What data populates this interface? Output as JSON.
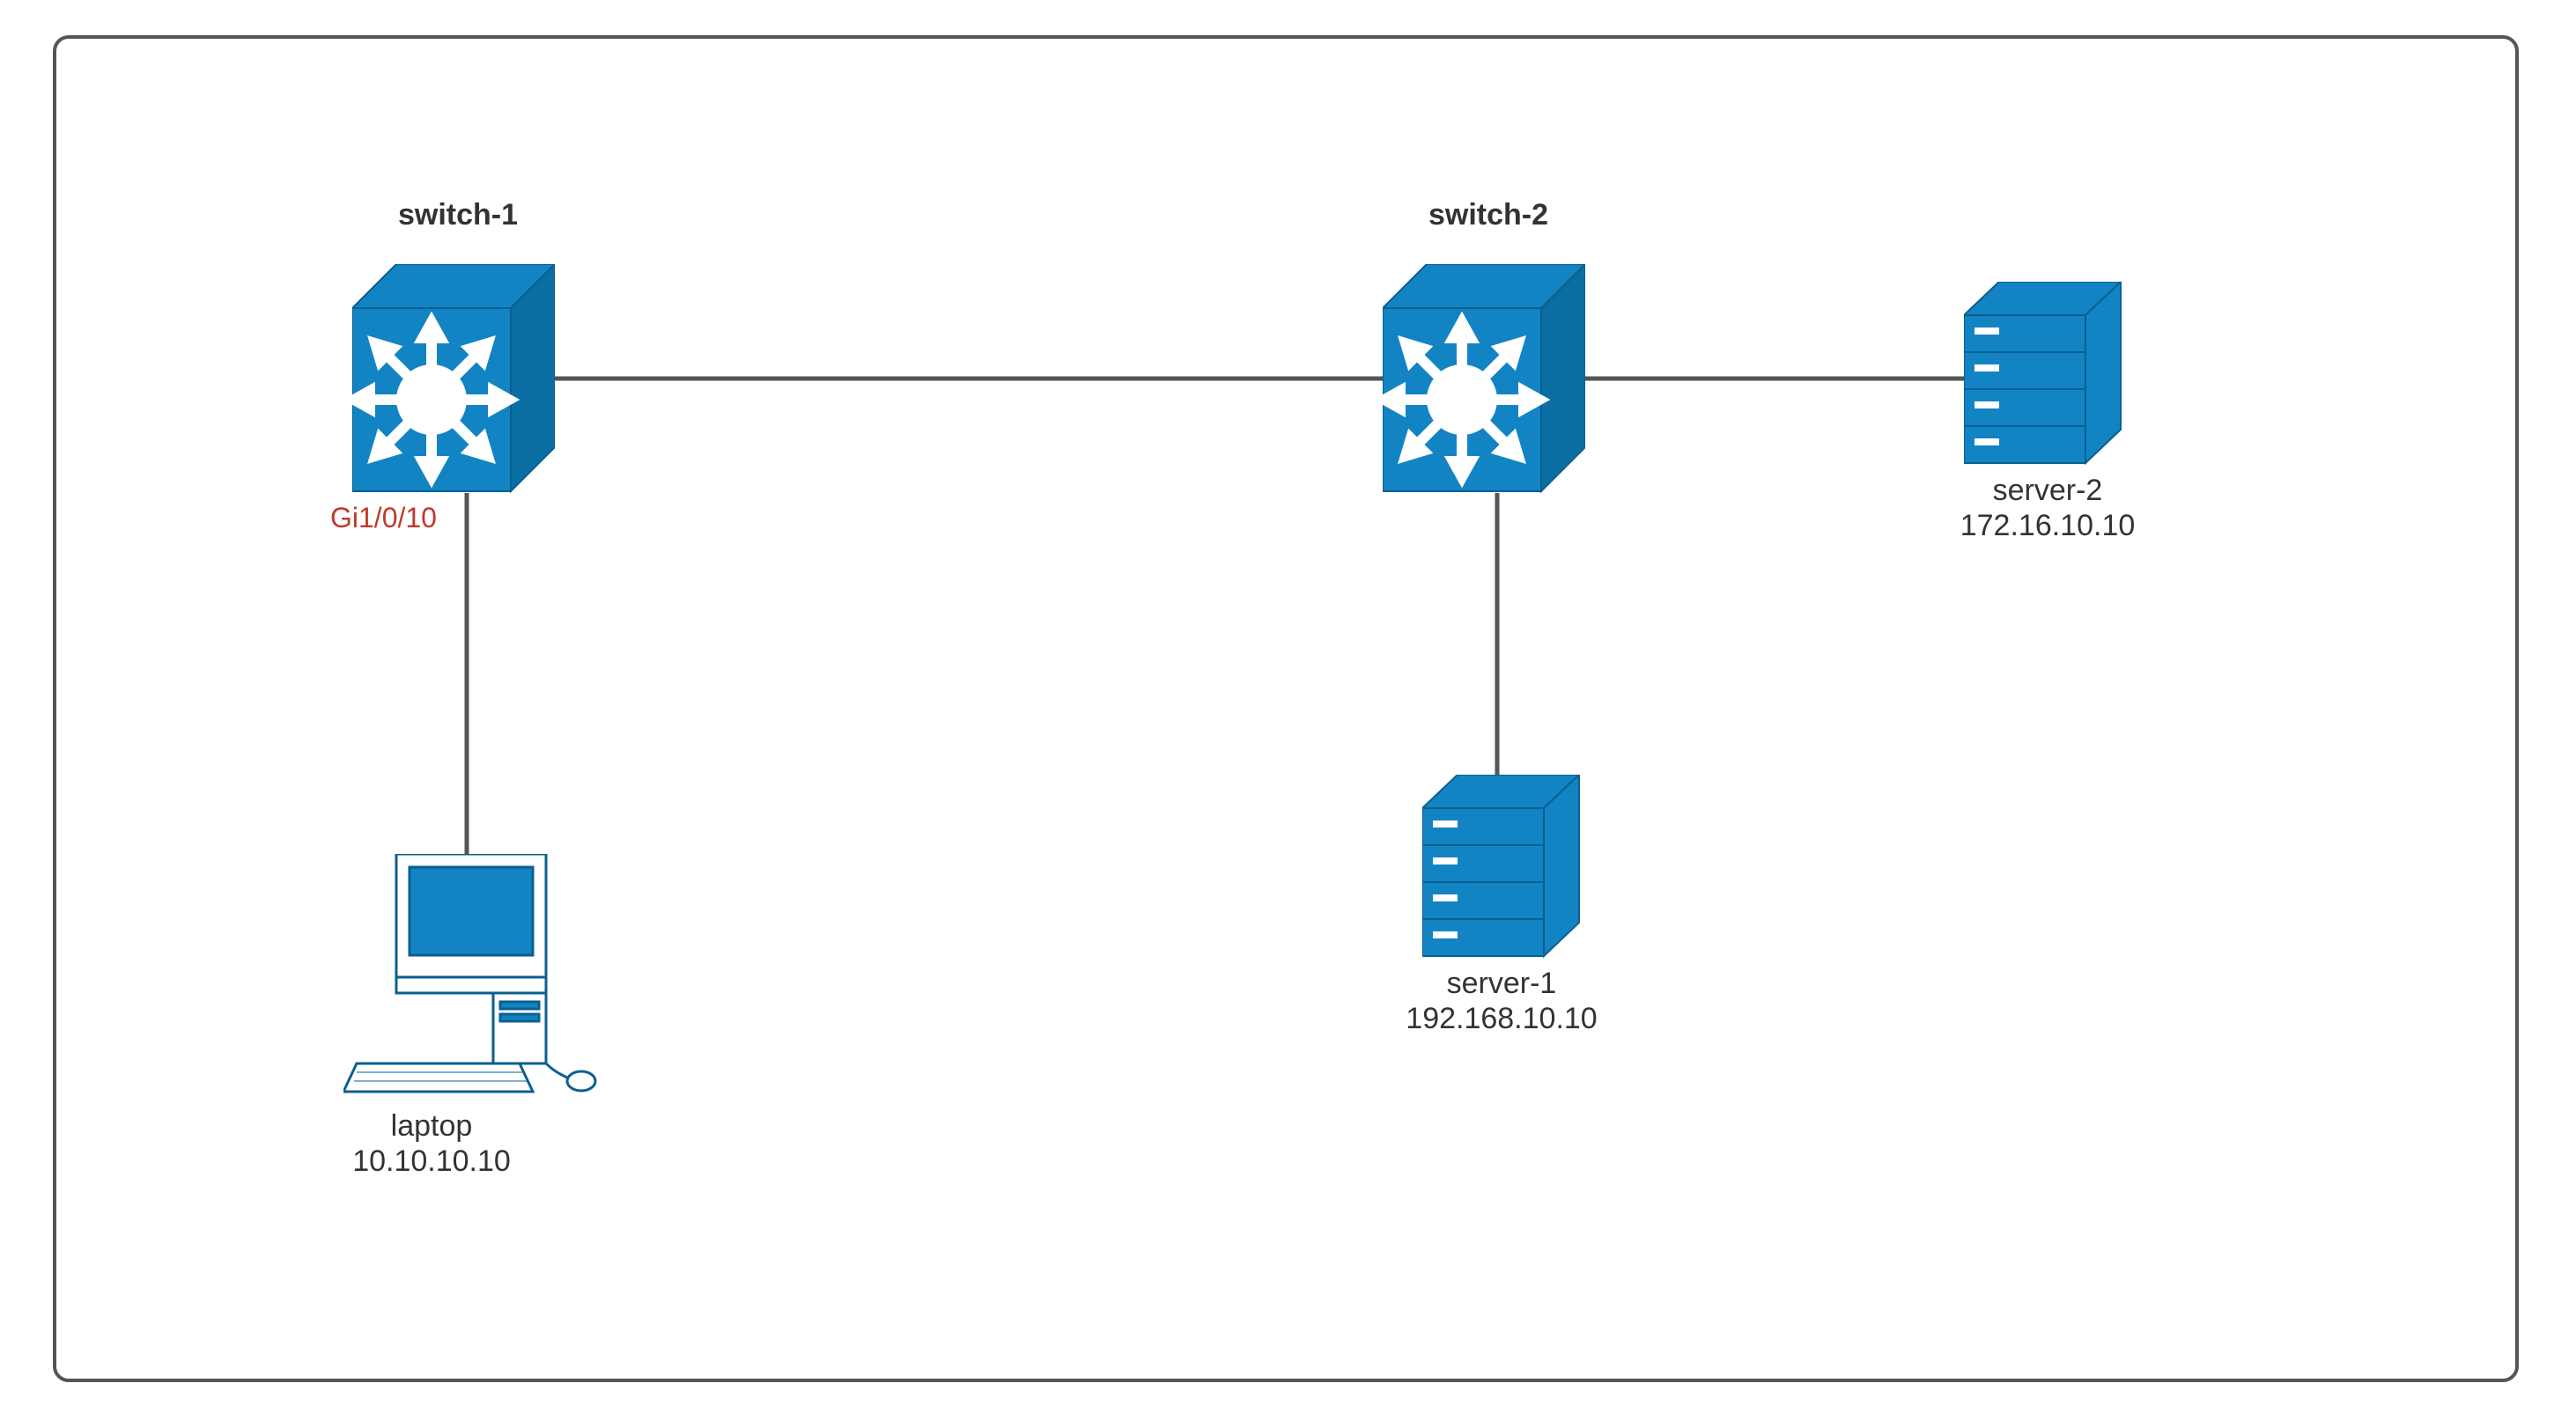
{
  "nodes": {
    "switch1": {
      "label": "switch-1",
      "port": "Gi1/0/10"
    },
    "switch2": {
      "label": "switch-2"
    },
    "laptop": {
      "label1": "laptop",
      "label2": "10.10.10.10"
    },
    "server1": {
      "label1": "server-1",
      "label2": "192.168.10.10"
    },
    "server2": {
      "label1": "server-2",
      "label2": "172.16.10.10"
    }
  },
  "colors": {
    "cisco_blue": "#1284c4",
    "line_gray": "#555555",
    "port_red": "#c0392b"
  },
  "connections": [
    {
      "from": "switch1",
      "to": "switch2"
    },
    {
      "from": "switch1",
      "to": "laptop"
    },
    {
      "from": "switch2",
      "to": "server1"
    },
    {
      "from": "switch2",
      "to": "server2"
    }
  ]
}
